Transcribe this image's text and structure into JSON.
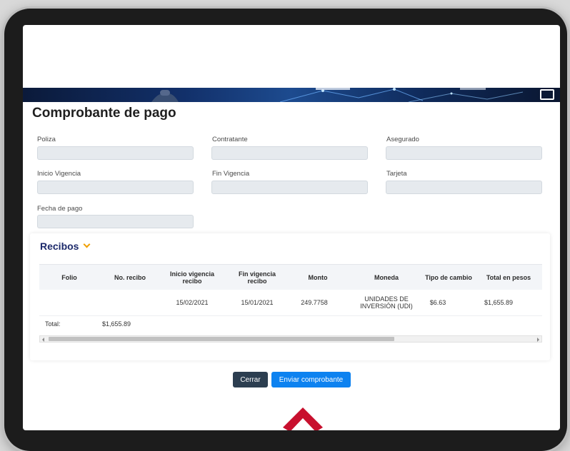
{
  "page": {
    "title": "Comprobante de pago"
  },
  "form": {
    "poliza": {
      "label": "Poliza",
      "value": ""
    },
    "contratante": {
      "label": "Contratante",
      "value": ""
    },
    "asegurado": {
      "label": "Asegurado",
      "value": ""
    },
    "inicio_vigencia": {
      "label": "Inicio Vigencia",
      "value": ""
    },
    "fin_vigencia": {
      "label": "Fin Vigencia",
      "value": ""
    },
    "tarjeta": {
      "label": "Tarjeta",
      "value": ""
    },
    "fecha_pago": {
      "label": "Fecha de pago",
      "value": ""
    }
  },
  "recibos": {
    "title": "Recibos",
    "columns": [
      "Folio",
      "No. recibo",
      "Inicio vigencia recibo",
      "Fin vigencia recibo",
      "Monto",
      "Moneda",
      "Tipo de cambio",
      "Total en pesos"
    ],
    "rows": [
      {
        "folio": "",
        "no_recibo": "",
        "inicio_vigencia": "15/02/2021",
        "fin_vigencia": "15/01/2021",
        "monto": "249.7758",
        "moneda": "UNIDADES DE INVERSIÓN (UDI)",
        "tipo_cambio": "$6.63",
        "total_pesos": "$1,655.89"
      }
    ],
    "total_label": "Total:",
    "total_value": "$1,655.89"
  },
  "buttons": {
    "close": "Cerrar",
    "send": "Enviar comprobante"
  },
  "colors": {
    "accent_blue": "#0d82f0",
    "dark_button": "#2c3e50",
    "recibos_title": "#1d2a6b",
    "chevron": "#f0a000",
    "fab_red": "#c8102e"
  },
  "icons": {
    "banner_image": "image-icon",
    "recibos_toggle": "chevron-down-icon",
    "scroll_to_top": "chevron-up-icon"
  }
}
